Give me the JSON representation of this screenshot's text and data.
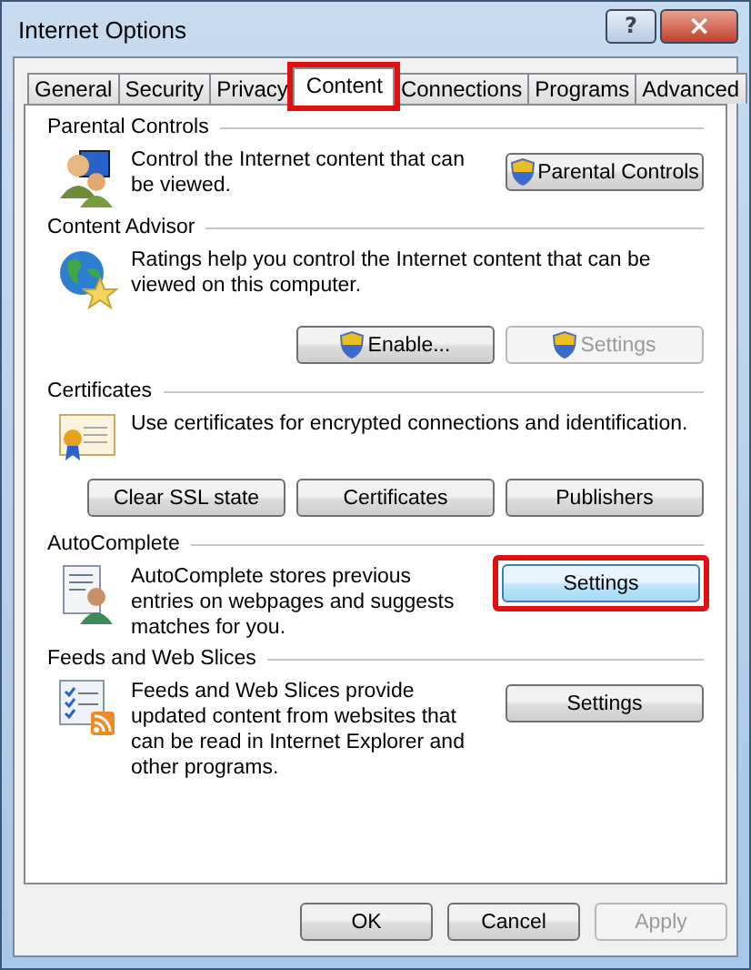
{
  "window": {
    "title": "Internet Options",
    "help": "?",
    "close": "×"
  },
  "tabs": [
    {
      "label": "General",
      "selected": false,
      "highlighted": false
    },
    {
      "label": "Security",
      "selected": false,
      "highlighted": false
    },
    {
      "label": "Privacy",
      "selected": false,
      "highlighted": false
    },
    {
      "label": "Content",
      "selected": true,
      "highlighted": true
    },
    {
      "label": "Connections",
      "selected": false,
      "highlighted": false
    },
    {
      "label": "Programs",
      "selected": false,
      "highlighted": false
    },
    {
      "label": "Advanced",
      "selected": false,
      "highlighted": false
    }
  ],
  "sections": [
    {
      "title": "Parental Controls",
      "kind": "side",
      "text": "Control the Internet content that can be viewed.",
      "buttons": [
        {
          "label": "Parental Controls",
          "shield": true,
          "disabled": false,
          "focused": false,
          "highlighted": false
        }
      ]
    },
    {
      "title": "Content Advisor",
      "kind": "below",
      "text": "Ratings help you control the Internet content that can be viewed on this computer.",
      "buttons": [
        {
          "label": "Enable...",
          "shield": true,
          "disabled": false,
          "focused": false,
          "highlighted": false
        },
        {
          "label": "Settings",
          "shield": true,
          "disabled": true,
          "focused": false,
          "highlighted": false
        }
      ]
    },
    {
      "title": "Certificates",
      "kind": "below",
      "text": "Use certificates for encrypted connections and identification.",
      "buttons": [
        {
          "label": "Clear SSL state",
          "shield": false,
          "disabled": false,
          "focused": false,
          "highlighted": false
        },
        {
          "label": "Certificates",
          "shield": false,
          "disabled": false,
          "focused": false,
          "highlighted": false
        },
        {
          "label": "Publishers",
          "shield": false,
          "disabled": false,
          "focused": false,
          "highlighted": false
        }
      ]
    },
    {
      "title": "AutoComplete",
      "kind": "side",
      "text": "AutoComplete stores previous entries on webpages and suggests matches for you.",
      "buttons": [
        {
          "label": "Settings",
          "shield": false,
          "disabled": false,
          "focused": true,
          "highlighted": true
        }
      ]
    },
    {
      "title": "Feeds and Web Slices",
      "kind": "side",
      "text": "Feeds and Web Slices provide updated content from websites that can be read in Internet Explorer and other programs.",
      "buttons": [
        {
          "label": "Settings",
          "shield": false,
          "disabled": false,
          "focused": false,
          "highlighted": false
        }
      ]
    }
  ],
  "footer": [
    {
      "label": "OK",
      "disabled": false
    },
    {
      "label": "Cancel",
      "disabled": false
    },
    {
      "label": "Apply",
      "disabled": true
    }
  ]
}
